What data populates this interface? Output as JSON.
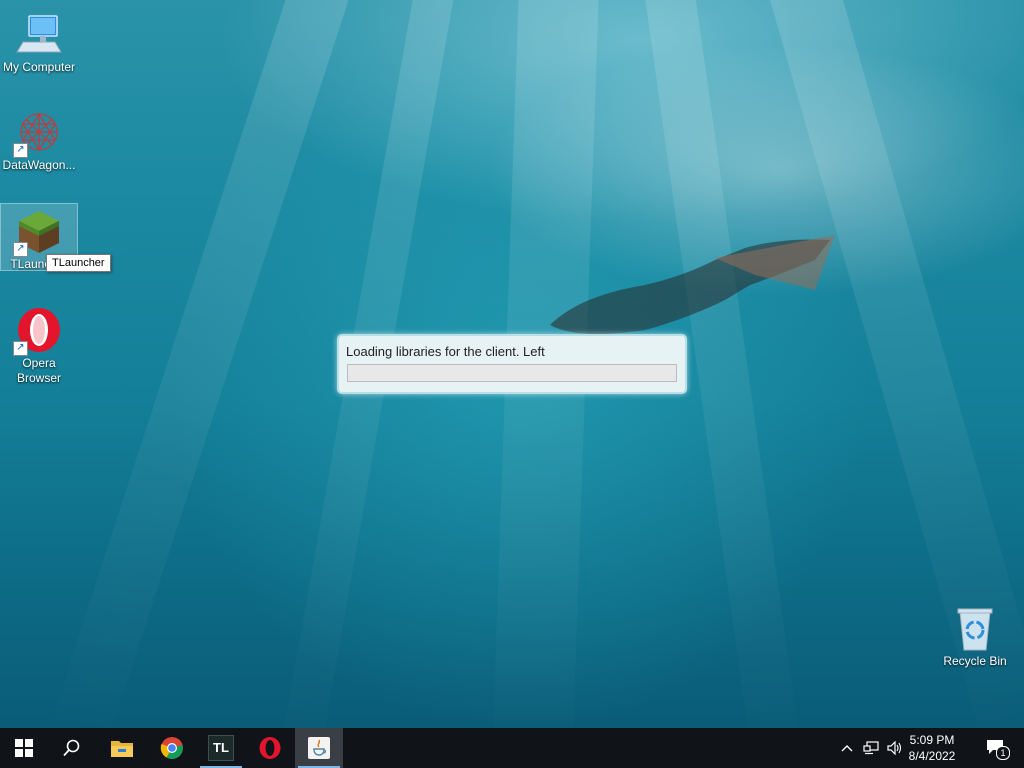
{
  "desktop": {
    "icons": [
      {
        "label": "My Computer",
        "icon": "computer-icon"
      },
      {
        "label": "DataWagon...",
        "icon": "datawagon-icon"
      },
      {
        "label": "TLauncher",
        "icon": "grass-block-icon"
      },
      {
        "label": "Opera\nBrowser",
        "icon": "opera-icon"
      },
      {
        "label": "Recycle Bin",
        "icon": "recycle-bin-icon"
      }
    ],
    "tooltip": "TLauncher"
  },
  "loader": {
    "message": "Loading libraries for the client. Left",
    "progress": 0
  },
  "taskbar": {
    "buttons": [
      "windows-start-icon",
      "search-icon",
      "file-explorer-icon",
      "chrome-icon",
      "tlauncher-icon",
      "opera-icon",
      "java-icon"
    ],
    "tlauncher_label": "TL",
    "clock": {
      "time": "5:09 PM",
      "date": "8/4/2022"
    },
    "notification_count": "1"
  },
  "colors": {
    "taskbar": "#101418",
    "accent": "#7fb6e8",
    "opera_red": "#e3152c"
  }
}
